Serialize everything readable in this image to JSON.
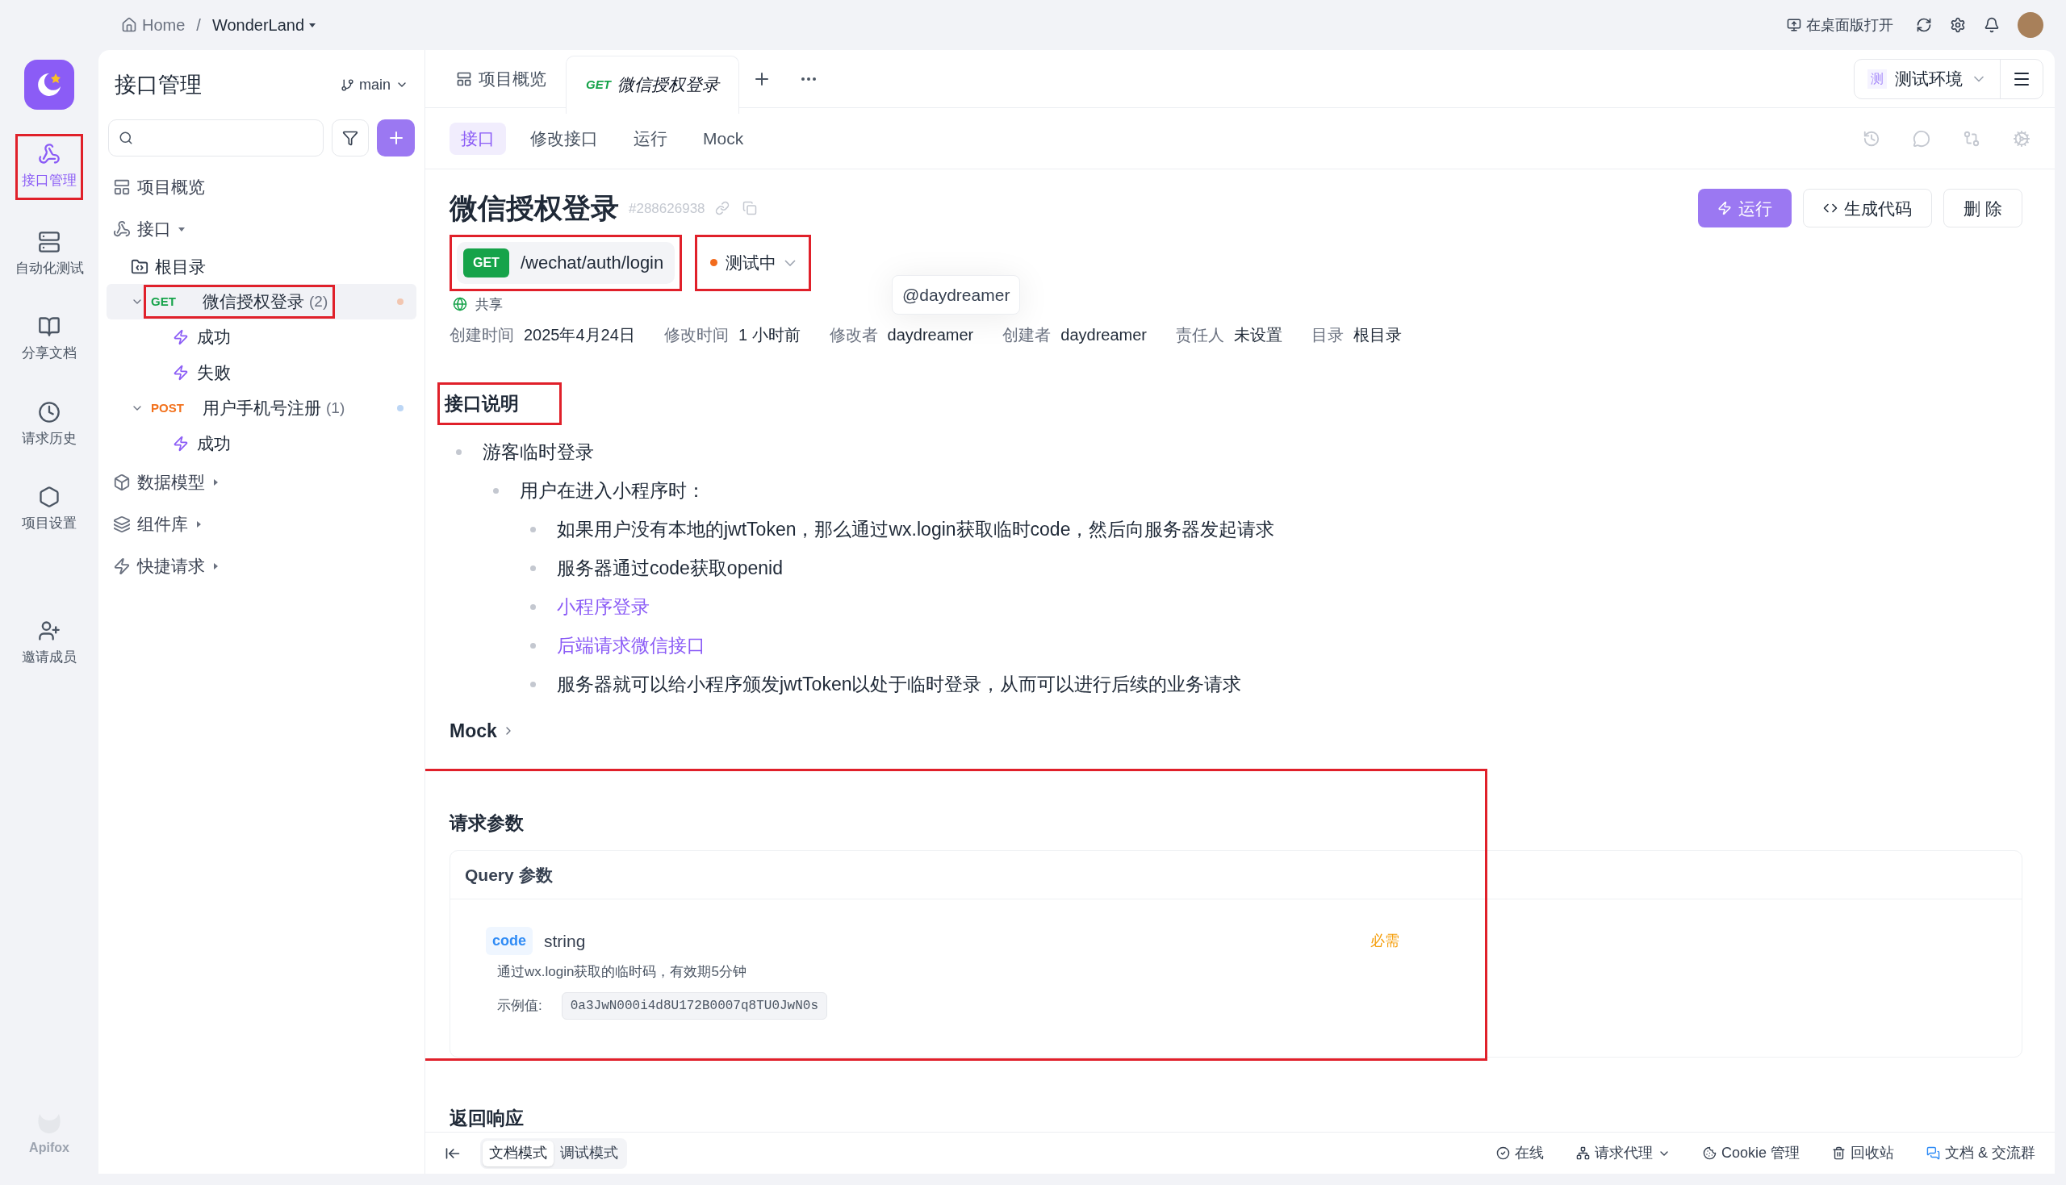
{
  "breadcrumb": {
    "home": "Home",
    "separator": "/",
    "project": "WonderLand"
  },
  "top_actions": {
    "open_desktop": "在桌面版打开"
  },
  "nav": [
    {
      "label": "接口管理",
      "selected": true,
      "highlighted": true
    },
    {
      "label": "自动化测试",
      "selected": false,
      "highlighted": false
    },
    {
      "label": "分享文档",
      "selected": false,
      "highlighted": false
    },
    {
      "label": "请求历史",
      "selected": false,
      "highlighted": false
    },
    {
      "label": "项目设置",
      "selected": false,
      "highlighted": false
    },
    {
      "label": "邀请成员",
      "selected": false,
      "highlighted": false
    }
  ],
  "nav_footer": "Apifox",
  "tree_panel": {
    "title": "接口管理",
    "branch": "main"
  },
  "tree": [
    {
      "kind": "section",
      "label": "项目概览"
    },
    {
      "kind": "group",
      "label": "接口",
      "expanded": true,
      "children": [
        {
          "kind": "folder",
          "label": "根目录"
        },
        {
          "kind": "endpoint",
          "method": "GET",
          "label": "微信授权登录",
          "count": "(2)",
          "selected": true,
          "highlighted": true,
          "expanded": true,
          "color": "#f2c6b0",
          "children": [
            {
              "kind": "case",
              "label": "成功"
            },
            {
              "kind": "case",
              "label": "失败"
            }
          ]
        },
        {
          "kind": "endpoint",
          "method": "POST",
          "label": "用户手机号注册",
          "count": "(1)",
          "selected": false,
          "highlighted": false,
          "expanded": true,
          "color": "#bcd6f5",
          "children": [
            {
              "kind": "case",
              "label": "成功"
            }
          ]
        }
      ]
    },
    {
      "kind": "group",
      "label": "数据模型",
      "expanded": false
    },
    {
      "kind": "group",
      "label": "组件库",
      "expanded": false
    },
    {
      "kind": "group",
      "label": "快捷请求",
      "expanded": false
    }
  ],
  "tabs": [
    {
      "label": "项目概览",
      "selected": false
    },
    {
      "method": "GET",
      "label": "微信授权登录",
      "selected": true
    }
  ],
  "environment": {
    "badge": "测",
    "label": "测试环境"
  },
  "subtabs": [
    {
      "label": "接口",
      "selected": true
    },
    {
      "label": "修改接口",
      "selected": false
    },
    {
      "label": "运行",
      "selected": false
    },
    {
      "label": "Mock",
      "selected": false
    }
  ],
  "endpoint": {
    "title": "微信授权登录",
    "id": "#288626938",
    "method": "GET",
    "path": "/wechat/auth/login",
    "path_highlighted": true,
    "status": {
      "label": "测试中",
      "color": "#f26b1d",
      "highlighted": true
    },
    "tooltip": "@daydreamer",
    "shared": "共享",
    "meta": [
      {
        "label": "创建时间",
        "value": "2025年4月24日"
      },
      {
        "label": "修改时间",
        "value": "1 小时前"
      },
      {
        "label": "修改者",
        "value": "daydreamer"
      },
      {
        "label": "创建者",
        "value": "daydreamer"
      },
      {
        "label": "责任人",
        "value": "未设置"
      },
      {
        "label": "目录",
        "value": "根目录"
      }
    ]
  },
  "actions": [
    {
      "label": "运行",
      "kind": "primary"
    },
    {
      "label": "生成代码",
      "kind": "code"
    },
    {
      "label": "删 除",
      "kind": "plain"
    }
  ],
  "description": {
    "heading": "接口说明",
    "highlighted": true,
    "items": [
      {
        "text": "游客临时登录",
        "children": [
          {
            "text": "用户在进入小程序时：",
            "children": [
              {
                "text": "如果用户没有本地的jwtToken，那么通过wx.login获取临时code，然后向服务器发起请求"
              },
              {
                "text": "服务器通过code获取openid"
              },
              {
                "text": "小程序登录",
                "kind": "link"
              },
              {
                "text": "后端请求微信接口",
                "kind": "link"
              },
              {
                "text": "服务器就可以给小程序颁发jwtToken以处于临时登录，从而可以进行后续的业务请求"
              }
            ]
          }
        ]
      }
    ]
  },
  "mock": {
    "label": "Mock"
  },
  "request_params": {
    "heading": "请求参数",
    "highlighted": true,
    "query_title": "Query 参数",
    "params": [
      {
        "name": "code",
        "type": "string",
        "required": "必需",
        "description": "通过wx.login获取的临时码，有效期5分钟",
        "example_label": "示例值:",
        "example": "0a3JwN000i4d8U172B0007q8TU0JwN0s"
      }
    ]
  },
  "response": {
    "heading": "返回响应"
  },
  "bottom_bar": {
    "modes": [
      {
        "label": "文档模式",
        "selected": true
      },
      {
        "label": "调试模式",
        "selected": false
      }
    ],
    "items": [
      {
        "label": "在线",
        "kind": "online"
      },
      {
        "label": "请求代理",
        "kind": "proxy"
      },
      {
        "label": "Cookie 管理",
        "kind": "cookie"
      },
      {
        "label": "回收站",
        "kind": "trash"
      },
      {
        "label": "文档 & 交流群",
        "kind": "docs"
      }
    ]
  }
}
